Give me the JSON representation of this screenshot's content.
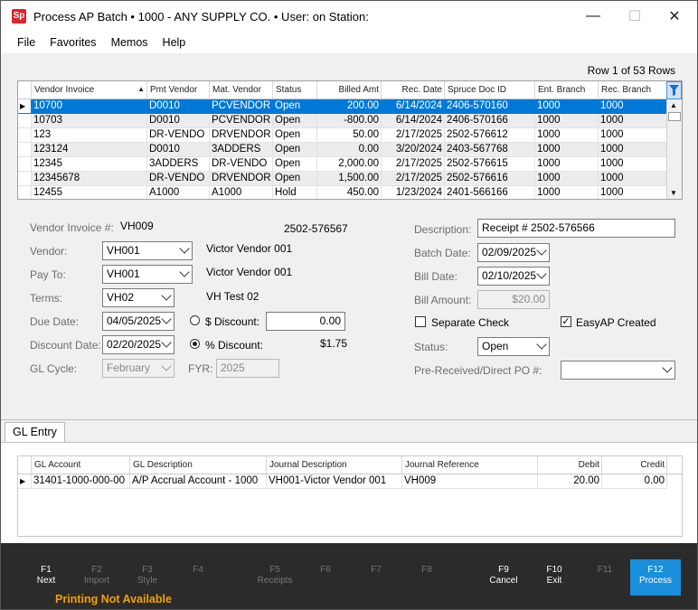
{
  "window": {
    "app_logo": "Sp",
    "title": "Process AP Batch  •  1000 - ANY SUPPLY CO.  •  User:           on Station:"
  },
  "menu": [
    "File",
    "Favorites",
    "Memos",
    "Help"
  ],
  "row_count": "Row 1 of 53 Rows",
  "invoice_grid": {
    "columns": [
      "Vendor Invoice",
      "Pmt Vendor",
      "Mat. Vendor",
      "Status",
      "Billed Amt",
      "Rec. Date",
      "Spruce Doc ID",
      "Ent. Branch",
      "Rec. Branch"
    ],
    "rows": [
      [
        "10700",
        "D0010",
        "PCVENDOR",
        "Open",
        "200.00",
        "6/14/2024",
        "2406-570160",
        "1000",
        "1000"
      ],
      [
        "10703",
        "D0010",
        "PCVENDOR",
        "Open",
        "-800.00",
        "6/14/2024",
        "2406-570166",
        "1000",
        "1000"
      ],
      [
        "123",
        "DR-VENDO",
        "DRVENDOR",
        "Open",
        "50.00",
        "2/17/2025",
        "2502-576612",
        "1000",
        "1000"
      ],
      [
        "123124",
        "D0010",
        "3ADDERS",
        "Open",
        "0.00",
        "3/20/2024",
        "2403-567768",
        "1000",
        "1000"
      ],
      [
        "12345",
        "3ADDERS",
        "DR-VENDO",
        "Open",
        "2,000.00",
        "2/17/2025",
        "2502-576615",
        "1000",
        "1000"
      ],
      [
        "12345678",
        "DR-VENDO",
        "DRVENDOR",
        "Open",
        "1,500.00",
        "2/17/2025",
        "2502-576616",
        "1000",
        "1000"
      ],
      [
        "12455",
        "A1000",
        "A1000",
        "Hold",
        "450.00",
        "1/23/2024",
        "2401-566166",
        "1000",
        "1000"
      ]
    ]
  },
  "form": {
    "vendor_invoice_label": "Vendor Invoice #:",
    "vendor_invoice": "VH009",
    "doc_id": "2502-576567",
    "vendor_label": "Vendor:",
    "vendor": "VH001",
    "vendor_name": "Victor Vendor 001",
    "payto_label": "Pay To:",
    "payto": "VH001",
    "payto_name": "Victor Vendor 001",
    "terms_label": "Terms:",
    "terms": "VH02",
    "terms_name": "VH Test 02",
    "due_date_label": "Due Date:",
    "due_date": "04/05/2025",
    "dollar_discount_label": "$ Discount:",
    "dollar_discount": "0.00",
    "discount_date_label": "Discount Date:",
    "discount_date": "02/20/2025",
    "pct_discount_label": "% Discount:",
    "pct_discount": "$1.75",
    "gl_cycle_label": "GL Cycle:",
    "gl_cycle": "February",
    "fyr_label": "FYR:",
    "fyr": "2025",
    "description_label": "Description:",
    "description": "Receipt # 2502-576566",
    "batch_date_label": "Batch Date:",
    "batch_date": "02/09/2025",
    "bill_date_label": "Bill Date:",
    "bill_date": "02/10/2025",
    "bill_amount_label": "Bill Amount:",
    "bill_amount": "$20.00",
    "separate_check_label": "Separate Check",
    "easyap_label": "EasyAP Created",
    "status_label": "Status:",
    "status": "Open",
    "pre_received_label": "Pre-Received/Direct PO #:",
    "pre_received": ""
  },
  "gl_tab": "GL Entry",
  "gl_grid": {
    "columns": [
      "GL Account",
      "GL Description",
      "Journal Description",
      "Journal Reference",
      "Debit",
      "Credit"
    ],
    "rows": [
      [
        "31401-1000-000-00",
        "A/P Accrual Account - 1000",
        "VH001-Victor Vendor 001",
        "VH009",
        "20.00",
        "0.00"
      ]
    ]
  },
  "footer": {
    "keys": [
      {
        "key": "F1",
        "label": "Next"
      },
      {
        "key": "F2",
        "label": "Import"
      },
      {
        "key": "F3",
        "label": "Style"
      },
      {
        "key": "F4",
        "label": ""
      },
      {
        "key": "F5",
        "label": "Receipts"
      },
      {
        "key": "F6",
        "label": ""
      },
      {
        "key": "F7",
        "label": ""
      },
      {
        "key": "F8",
        "label": ""
      },
      {
        "key": "F9",
        "label": "Cancel"
      },
      {
        "key": "F10",
        "label": "Exit"
      },
      {
        "key": "F11",
        "label": ""
      },
      {
        "key": "F12",
        "label": "Process"
      }
    ],
    "printing": "Printing Not Available"
  },
  "colors": {
    "selected_row": "#0078d7",
    "accent_button": "#1a8fdc",
    "footer_bg": "#2b2b2b",
    "warning_text": "#f4a000"
  }
}
